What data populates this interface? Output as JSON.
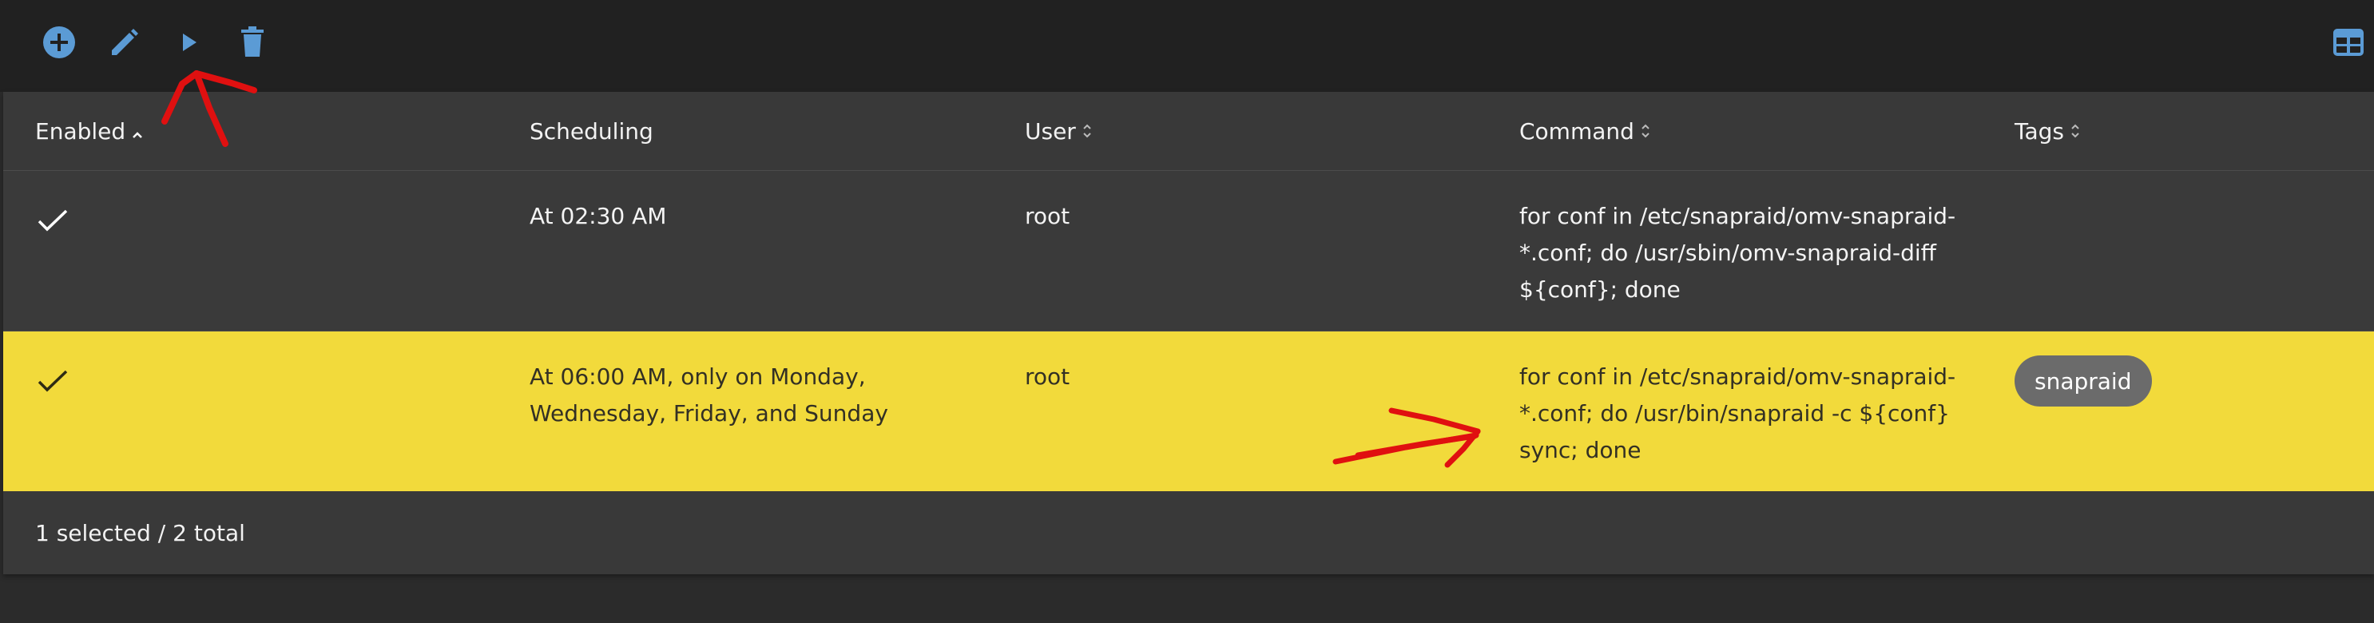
{
  "toolbar": {
    "buttons": [
      {
        "icon": "plus-circle-icon",
        "label": "Create"
      },
      {
        "icon": "pencil-icon",
        "label": "Edit"
      },
      {
        "icon": "play-icon",
        "label": "Run"
      },
      {
        "icon": "trash-icon",
        "label": "Delete"
      }
    ],
    "column_toggle_icon": "table-columns-icon",
    "icon_color": "#5b9bd5"
  },
  "table": {
    "columns": [
      {
        "label": "Enabled",
        "sort": "ascending"
      },
      {
        "label": "Scheduling",
        "sort": "none"
      },
      {
        "label": "User",
        "sort": "unsorted"
      },
      {
        "label": "Command",
        "sort": "unsorted"
      },
      {
        "label": "Tags",
        "sort": "unsorted"
      }
    ],
    "rows": [
      {
        "enabled": true,
        "selected": false,
        "scheduling": [
          "At 02:30 AM"
        ],
        "user": "root",
        "command": [
          "for conf in /etc/snapraid/omv-snapraid-",
          "*.conf; do /usr/sbin/omv-snapraid-diff",
          "${conf}; done"
        ],
        "tags": []
      },
      {
        "enabled": true,
        "selected": true,
        "scheduling": [
          "At 06:00 AM, only on Monday,",
          "Wednesday, Friday, and Sunday"
        ],
        "user": "root",
        "command": [
          "for conf in /etc/snapraid/omv-snapraid-",
          "*.conf; do /usr/bin/snapraid -c ${conf}",
          "sync; done"
        ],
        "tags": [
          "snapraid"
        ]
      }
    ],
    "selected_row_color": "#f2da3b"
  },
  "footer": {
    "summary": "1 selected / 2 total"
  },
  "annotations": {
    "color": "#e01010",
    "marks": [
      "red-arrow-pointing-to-run-button",
      "red-arrow-pointing-to-snapraid-command"
    ]
  }
}
